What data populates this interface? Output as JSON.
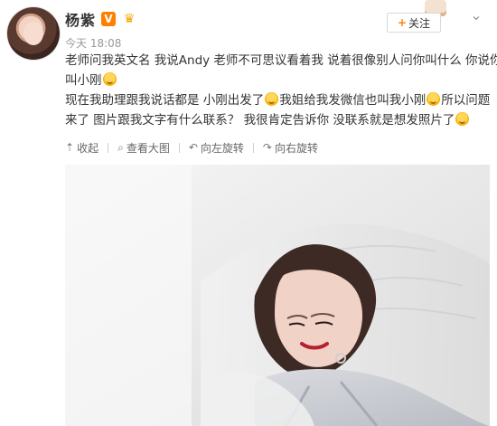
{
  "header": {
    "name": "杨紫",
    "verified_badge_text": "V",
    "time": "今天 18:08",
    "follow_button": {
      "plus": "+",
      "label": "关注"
    }
  },
  "post": {
    "lines": [
      "老师问我英文名 我说Andy 老师不可思议看着我 说着很像别人问你叫什么 你说你",
      "叫小刚",
      "现在我助理跟我说话都是 小刚出发了",
      "我姐给我发微信也叫我小刚",
      "所以问题",
      "来了 图片跟我文字有什么联系？ 我很肯定告诉你 没联系就是想发照片了"
    ]
  },
  "toolbar": {
    "collect": "收起",
    "view_large": "查看大图",
    "rotate_left": "向左旋转",
    "rotate_right": "向右旋转"
  },
  "icons": {
    "avatar": "avatar",
    "vip_badge": "vip-badge-icon",
    "crown": "crown-icon",
    "menu": "chevron-down-icon",
    "emoji": "smile-emoji-icon",
    "collect_icon": "arrow-up-icon",
    "view_icon": "search-icon",
    "rotate_left_icon": "rotate-left-icon",
    "rotate_right_icon": "rotate-right-icon"
  },
  "colors": {
    "accent": "#ff8200",
    "text": "#333333",
    "muted": "#999999"
  }
}
